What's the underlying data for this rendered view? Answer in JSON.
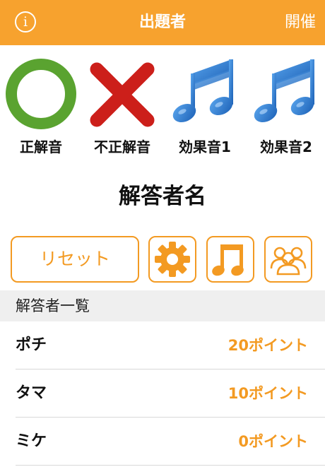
{
  "navbar": {
    "info_icon": "info-icon",
    "info_glyph": "i",
    "title": "出題者",
    "right_label": "開催"
  },
  "sounds": [
    {
      "label": "正解音",
      "icon": "circle-icon",
      "color": "#5aa330"
    },
    {
      "label": "不正解音",
      "icon": "cross-icon",
      "color": "#cc1f1a"
    },
    {
      "label": "効果音1",
      "icon": "music-note-icon",
      "color": "#2a73c9"
    },
    {
      "label": "効果音2",
      "icon": "music-note-icon",
      "color": "#2a73c9"
    }
  ],
  "answerer_name": "解答者名",
  "controls": {
    "reset_label": "リセット",
    "settings_icon": "gear-icon",
    "music_icon": "music-note-icon",
    "group_icon": "group-icon",
    "accent": "#f39a22"
  },
  "list": {
    "header": "解答者一覧",
    "rows": [
      {
        "name": "ポチ",
        "points": "20ポイント"
      },
      {
        "name": "タマ",
        "points": "10ポイント"
      },
      {
        "name": "ミケ",
        "points": "0ポイント"
      }
    ]
  }
}
